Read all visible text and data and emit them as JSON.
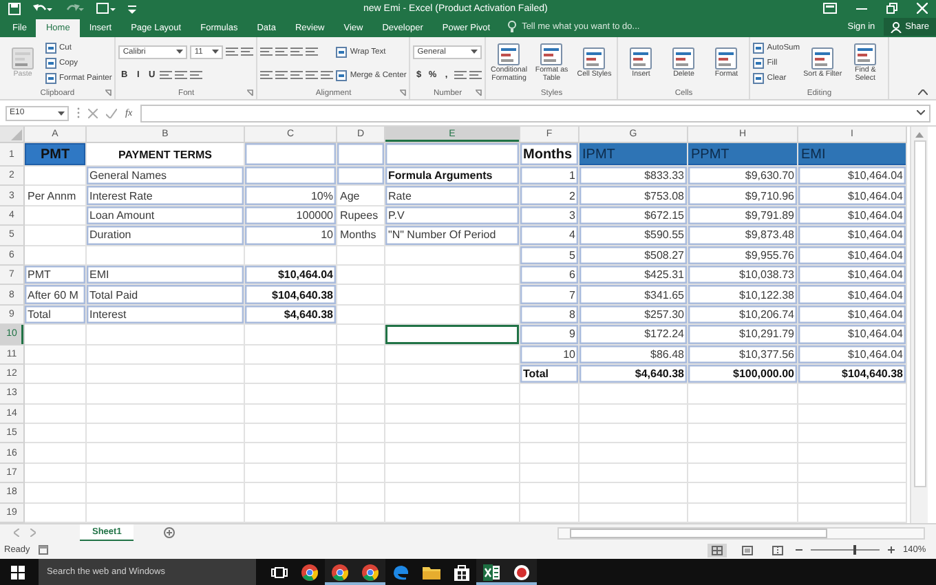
{
  "window": {
    "title": "new Emi - Excel (Product Activation Failed)"
  },
  "menu_tabs": [
    {
      "label": "File",
      "selected": false
    },
    {
      "label": "Home",
      "selected": true
    },
    {
      "label": "Insert",
      "selected": false
    },
    {
      "label": "Page Layout",
      "selected": false
    },
    {
      "label": "Formulas",
      "selected": false
    },
    {
      "label": "Data",
      "selected": false
    },
    {
      "label": "Review",
      "selected": false
    },
    {
      "label": "View",
      "selected": false
    },
    {
      "label": "Developer",
      "selected": false
    },
    {
      "label": "Power Pivot",
      "selected": false
    }
  ],
  "tell_me": {
    "placeholder": "Tell me what you want to do..."
  },
  "sign_in": "Sign in",
  "share": "Share",
  "ribbon": {
    "groups": [
      {
        "label": "Clipboard",
        "launcher": true,
        "columns": [
          [
            [
              {
                "kind": "big",
                "label": "Paste",
                "disabled": true
              }
            ]
          ],
          [
            [
              {
                "kind": "small",
                "label": "Cut",
                "disabled": false
              }
            ],
            [
              {
                "kind": "small",
                "label": "Copy",
                "disabled": false
              }
            ],
            [
              {
                "kind": "small",
                "label": "Format Painter",
                "disabled": false
              }
            ]
          ]
        ]
      },
      {
        "label": "Font",
        "launcher": true,
        "columns": [
          [
            [
              {
                "kind": "field",
                "label": "Calibri"
              },
              {
                "kind": "field",
                "label": "11"
              },
              {
                "kind": "icon"
              },
              {
                "kind": "icon"
              }
            ],
            [
              {
                "kind": "glyph",
                "label": "B"
              },
              {
                "kind": "glyph",
                "label": "I"
              },
              {
                "kind": "glyph",
                "label": "U"
              },
              {
                "kind": "icon"
              },
              {
                "kind": "icon"
              },
              {
                "kind": "icon"
              }
            ]
          ]
        ]
      },
      {
        "label": "Alignment",
        "launcher": true,
        "columns": [
          [
            [
              {
                "kind": "icon"
              },
              {
                "kind": "icon"
              },
              {
                "kind": "icon"
              },
              {
                "kind": "icon"
              }
            ],
            [
              {
                "kind": "icon"
              },
              {
                "kind": "icon"
              },
              {
                "kind": "icon"
              },
              {
                "kind": "icon"
              },
              {
                "kind": "icon"
              }
            ]
          ],
          [
            [
              {
                "kind": "small",
                "label": "Wrap Text"
              }
            ],
            [
              {
                "kind": "small",
                "label": "Merge & Center"
              }
            ]
          ]
        ]
      },
      {
        "label": "Number",
        "launcher": true,
        "columns": [
          [
            [
              {
                "kind": "field",
                "label": "General"
              }
            ],
            [
              {
                "kind": "glyph",
                "label": "$"
              },
              {
                "kind": "glyph",
                "label": "%"
              },
              {
                "kind": "glyph",
                "label": ","
              },
              {
                "kind": "icon"
              },
              {
                "kind": "icon"
              }
            ]
          ]
        ]
      },
      {
        "label": "Styles",
        "launcher": false,
        "columns": [
          [
            [
              {
                "kind": "big",
                "label": "Conditional Formatting"
              }
            ]
          ],
          [
            [
              {
                "kind": "big",
                "label": "Format as Table"
              }
            ]
          ],
          [
            [
              {
                "kind": "big",
                "label": "Cell Styles"
              }
            ]
          ]
        ]
      },
      {
        "label": "Cells",
        "launcher": false,
        "columns": [
          [
            [
              {
                "kind": "big",
                "label": "Insert"
              }
            ]
          ],
          [
            [
              {
                "kind": "big",
                "label": "Delete"
              }
            ]
          ],
          [
            [
              {
                "kind": "big",
                "label": "Format"
              }
            ]
          ]
        ]
      },
      {
        "label": "Editing",
        "launcher": false,
        "columns": [
          [
            [
              {
                "kind": "small",
                "label": "AutoSum"
              }
            ],
            [
              {
                "kind": "small",
                "label": "Fill"
              }
            ],
            [
              {
                "kind": "small",
                "label": "Clear"
              }
            ]
          ],
          [
            [
              {
                "kind": "big",
                "label": "Sort & Filter"
              }
            ]
          ],
          [
            [
              {
                "kind": "big",
                "label": "Find & Select"
              }
            ]
          ]
        ]
      }
    ]
  },
  "formula_bar": {
    "name_box": "E10",
    "fx": "fx"
  },
  "grid": {
    "columns": [
      "A",
      "B",
      "C",
      "D",
      "E",
      "F",
      "G",
      "H",
      "I"
    ],
    "rows": [
      {
        "number": "1",
        "cells": [
          {
            "kind": "badge",
            "text": "PMT"
          },
          {
            "kind": "title",
            "text": "PAYMENT TERMS"
          },
          {
            "kind": "box"
          },
          {
            "kind": "box"
          },
          {
            "kind": "box"
          },
          {
            "kind": "bold-text",
            "text": "Months"
          },
          {
            "kind": "band",
            "text": "IPMT"
          },
          {
            "kind": "band",
            "text": "PPMT"
          },
          {
            "kind": "band",
            "text": "EMI"
          }
        ]
      },
      {
        "number": "2",
        "cells": [
          {
            "kind": "blank"
          },
          {
            "kind": "text",
            "text": "General Names"
          },
          {
            "kind": "box"
          },
          {
            "kind": "box"
          },
          {
            "kind": "bold-text",
            "text": "Formula Arguments"
          },
          {
            "kind": "num",
            "text": "1"
          },
          {
            "kind": "num",
            "text": "$833.33"
          },
          {
            "kind": "num",
            "text": "$9,630.70"
          },
          {
            "kind": "num",
            "text": "$10,464.04"
          }
        ]
      },
      {
        "number": "3",
        "cells": [
          {
            "kind": "plain",
            "text": "Per Annm"
          },
          {
            "kind": "text",
            "text": "Interest Rate"
          },
          {
            "kind": "num",
            "text": "10%"
          },
          {
            "kind": "plain",
            "text": "Age"
          },
          {
            "kind": "text",
            "text": "Rate"
          },
          {
            "kind": "num",
            "text": "2"
          },
          {
            "kind": "num",
            "text": "$753.08"
          },
          {
            "kind": "num",
            "text": "$9,710.96"
          },
          {
            "kind": "num",
            "text": "$10,464.04"
          }
        ]
      },
      {
        "number": "4",
        "cells": [
          {
            "kind": "blank"
          },
          {
            "kind": "text",
            "text": "Loan Amount"
          },
          {
            "kind": "num",
            "text": "100000"
          },
          {
            "kind": "plain",
            "text": "Rupees"
          },
          {
            "kind": "text",
            "text": "P.V"
          },
          {
            "kind": "num",
            "text": "3"
          },
          {
            "kind": "num",
            "text": "$672.15"
          },
          {
            "kind": "num",
            "text": "$9,791.89"
          },
          {
            "kind": "num",
            "text": "$10,464.04"
          }
        ]
      },
      {
        "number": "5",
        "cells": [
          {
            "kind": "blank"
          },
          {
            "kind": "text",
            "text": "Duration"
          },
          {
            "kind": "num",
            "text": "10"
          },
          {
            "kind": "plain",
            "text": "Months"
          },
          {
            "kind": "text",
            "text": "\"N\" Number Of Period"
          },
          {
            "kind": "num",
            "text": "4"
          },
          {
            "kind": "num",
            "text": "$590.55"
          },
          {
            "kind": "num",
            "text": "$9,873.48"
          },
          {
            "kind": "num",
            "text": "$10,464.04"
          }
        ]
      },
      {
        "number": "6",
        "cells": [
          {
            "kind": "blank"
          },
          {
            "kind": "blank"
          },
          {
            "kind": "blank"
          },
          {
            "kind": "blank"
          },
          {
            "kind": "blank"
          },
          {
            "kind": "num",
            "text": "5"
          },
          {
            "kind": "num",
            "text": "$508.27"
          },
          {
            "kind": "num",
            "text": "$9,955.76"
          },
          {
            "kind": "num",
            "text": "$10,464.04"
          }
        ]
      },
      {
        "number": "7",
        "cells": [
          {
            "kind": "text",
            "text": "PMT"
          },
          {
            "kind": "text",
            "text": "EMI"
          },
          {
            "kind": "bold-num",
            "text": "$10,464.04"
          },
          {
            "kind": "blank"
          },
          {
            "kind": "blank"
          },
          {
            "kind": "num",
            "text": "6"
          },
          {
            "kind": "num",
            "text": "$425.31"
          },
          {
            "kind": "num",
            "text": "$10,038.73"
          },
          {
            "kind": "num",
            "text": "$10,464.04"
          }
        ]
      },
      {
        "number": "8",
        "cells": [
          {
            "kind": "text",
            "text": "After 60 M"
          },
          {
            "kind": "text",
            "text": "Total Paid"
          },
          {
            "kind": "bold-num",
            "text": "$104,640.38"
          },
          {
            "kind": "blank"
          },
          {
            "kind": "blank"
          },
          {
            "kind": "num",
            "text": "7"
          },
          {
            "kind": "num",
            "text": "$341.65"
          },
          {
            "kind": "num",
            "text": "$10,122.38"
          },
          {
            "kind": "num",
            "text": "$10,464.04"
          }
        ]
      },
      {
        "number": "9",
        "cells": [
          {
            "kind": "text",
            "text": "Total"
          },
          {
            "kind": "text",
            "text": "Interest"
          },
          {
            "kind": "bold-num",
            "text": "$4,640.38"
          },
          {
            "kind": "blank"
          },
          {
            "kind": "blank"
          },
          {
            "kind": "num",
            "text": "8"
          },
          {
            "kind": "num",
            "text": "$257.30"
          },
          {
            "kind": "num",
            "text": "$10,206.74"
          },
          {
            "kind": "num",
            "text": "$10,464.04"
          }
        ]
      },
      {
        "number": "10",
        "cells": [
          {
            "kind": "blank"
          },
          {
            "kind": "blank"
          },
          {
            "kind": "blank"
          },
          {
            "kind": "blank"
          },
          {
            "kind": "blank",
            "selected": true
          },
          {
            "kind": "num",
            "text": "9"
          },
          {
            "kind": "num",
            "text": "$172.24"
          },
          {
            "kind": "num",
            "text": "$10,291.79"
          },
          {
            "kind": "num",
            "text": "$10,464.04"
          }
        ]
      },
      {
        "number": "11",
        "cells": [
          {
            "kind": "blank"
          },
          {
            "kind": "blank"
          },
          {
            "kind": "blank"
          },
          {
            "kind": "blank"
          },
          {
            "kind": "blank"
          },
          {
            "kind": "num",
            "text": "10"
          },
          {
            "kind": "num",
            "text": "$86.48"
          },
          {
            "kind": "num",
            "text": "$10,377.56"
          },
          {
            "kind": "num",
            "text": "$10,464.04"
          }
        ]
      },
      {
        "number": "12",
        "cells": [
          {
            "kind": "blank"
          },
          {
            "kind": "blank"
          },
          {
            "kind": "blank"
          },
          {
            "kind": "blank"
          },
          {
            "kind": "blank"
          },
          {
            "kind": "bold-text",
            "text": "Total"
          },
          {
            "kind": "bold-num",
            "text": "$4,640.38"
          },
          {
            "kind": "bold-num",
            "text": "$100,000.00"
          },
          {
            "kind": "bold-num",
            "text": "$104,640.38"
          }
        ]
      },
      {
        "number": "13"
      },
      {
        "number": "14"
      },
      {
        "number": "15"
      },
      {
        "number": "16"
      },
      {
        "number": "17"
      },
      {
        "number": "18"
      },
      {
        "number": "19"
      }
    ]
  },
  "sheet_tabs": [
    {
      "label": "Sheet1",
      "selected": true
    }
  ],
  "status_bar": {
    "status": "Ready",
    "zoom": {
      "level": 0.62,
      "reading": "140%"
    }
  },
  "taskbar": {
    "search": {
      "placeholder": "Search the web and Windows"
    },
    "apps": [
      {
        "kind": "taskview",
        "open": false
      },
      {
        "kind": "chrome",
        "open": false
      },
      {
        "kind": "chrome",
        "open": true
      },
      {
        "kind": "chrome",
        "open": true
      },
      {
        "kind": "edge",
        "open": false
      },
      {
        "kind": "folder",
        "open": false
      },
      {
        "kind": "store",
        "open": false
      },
      {
        "kind": "excel",
        "open": true
      },
      {
        "kind": "record",
        "open": true
      }
    ]
  }
}
